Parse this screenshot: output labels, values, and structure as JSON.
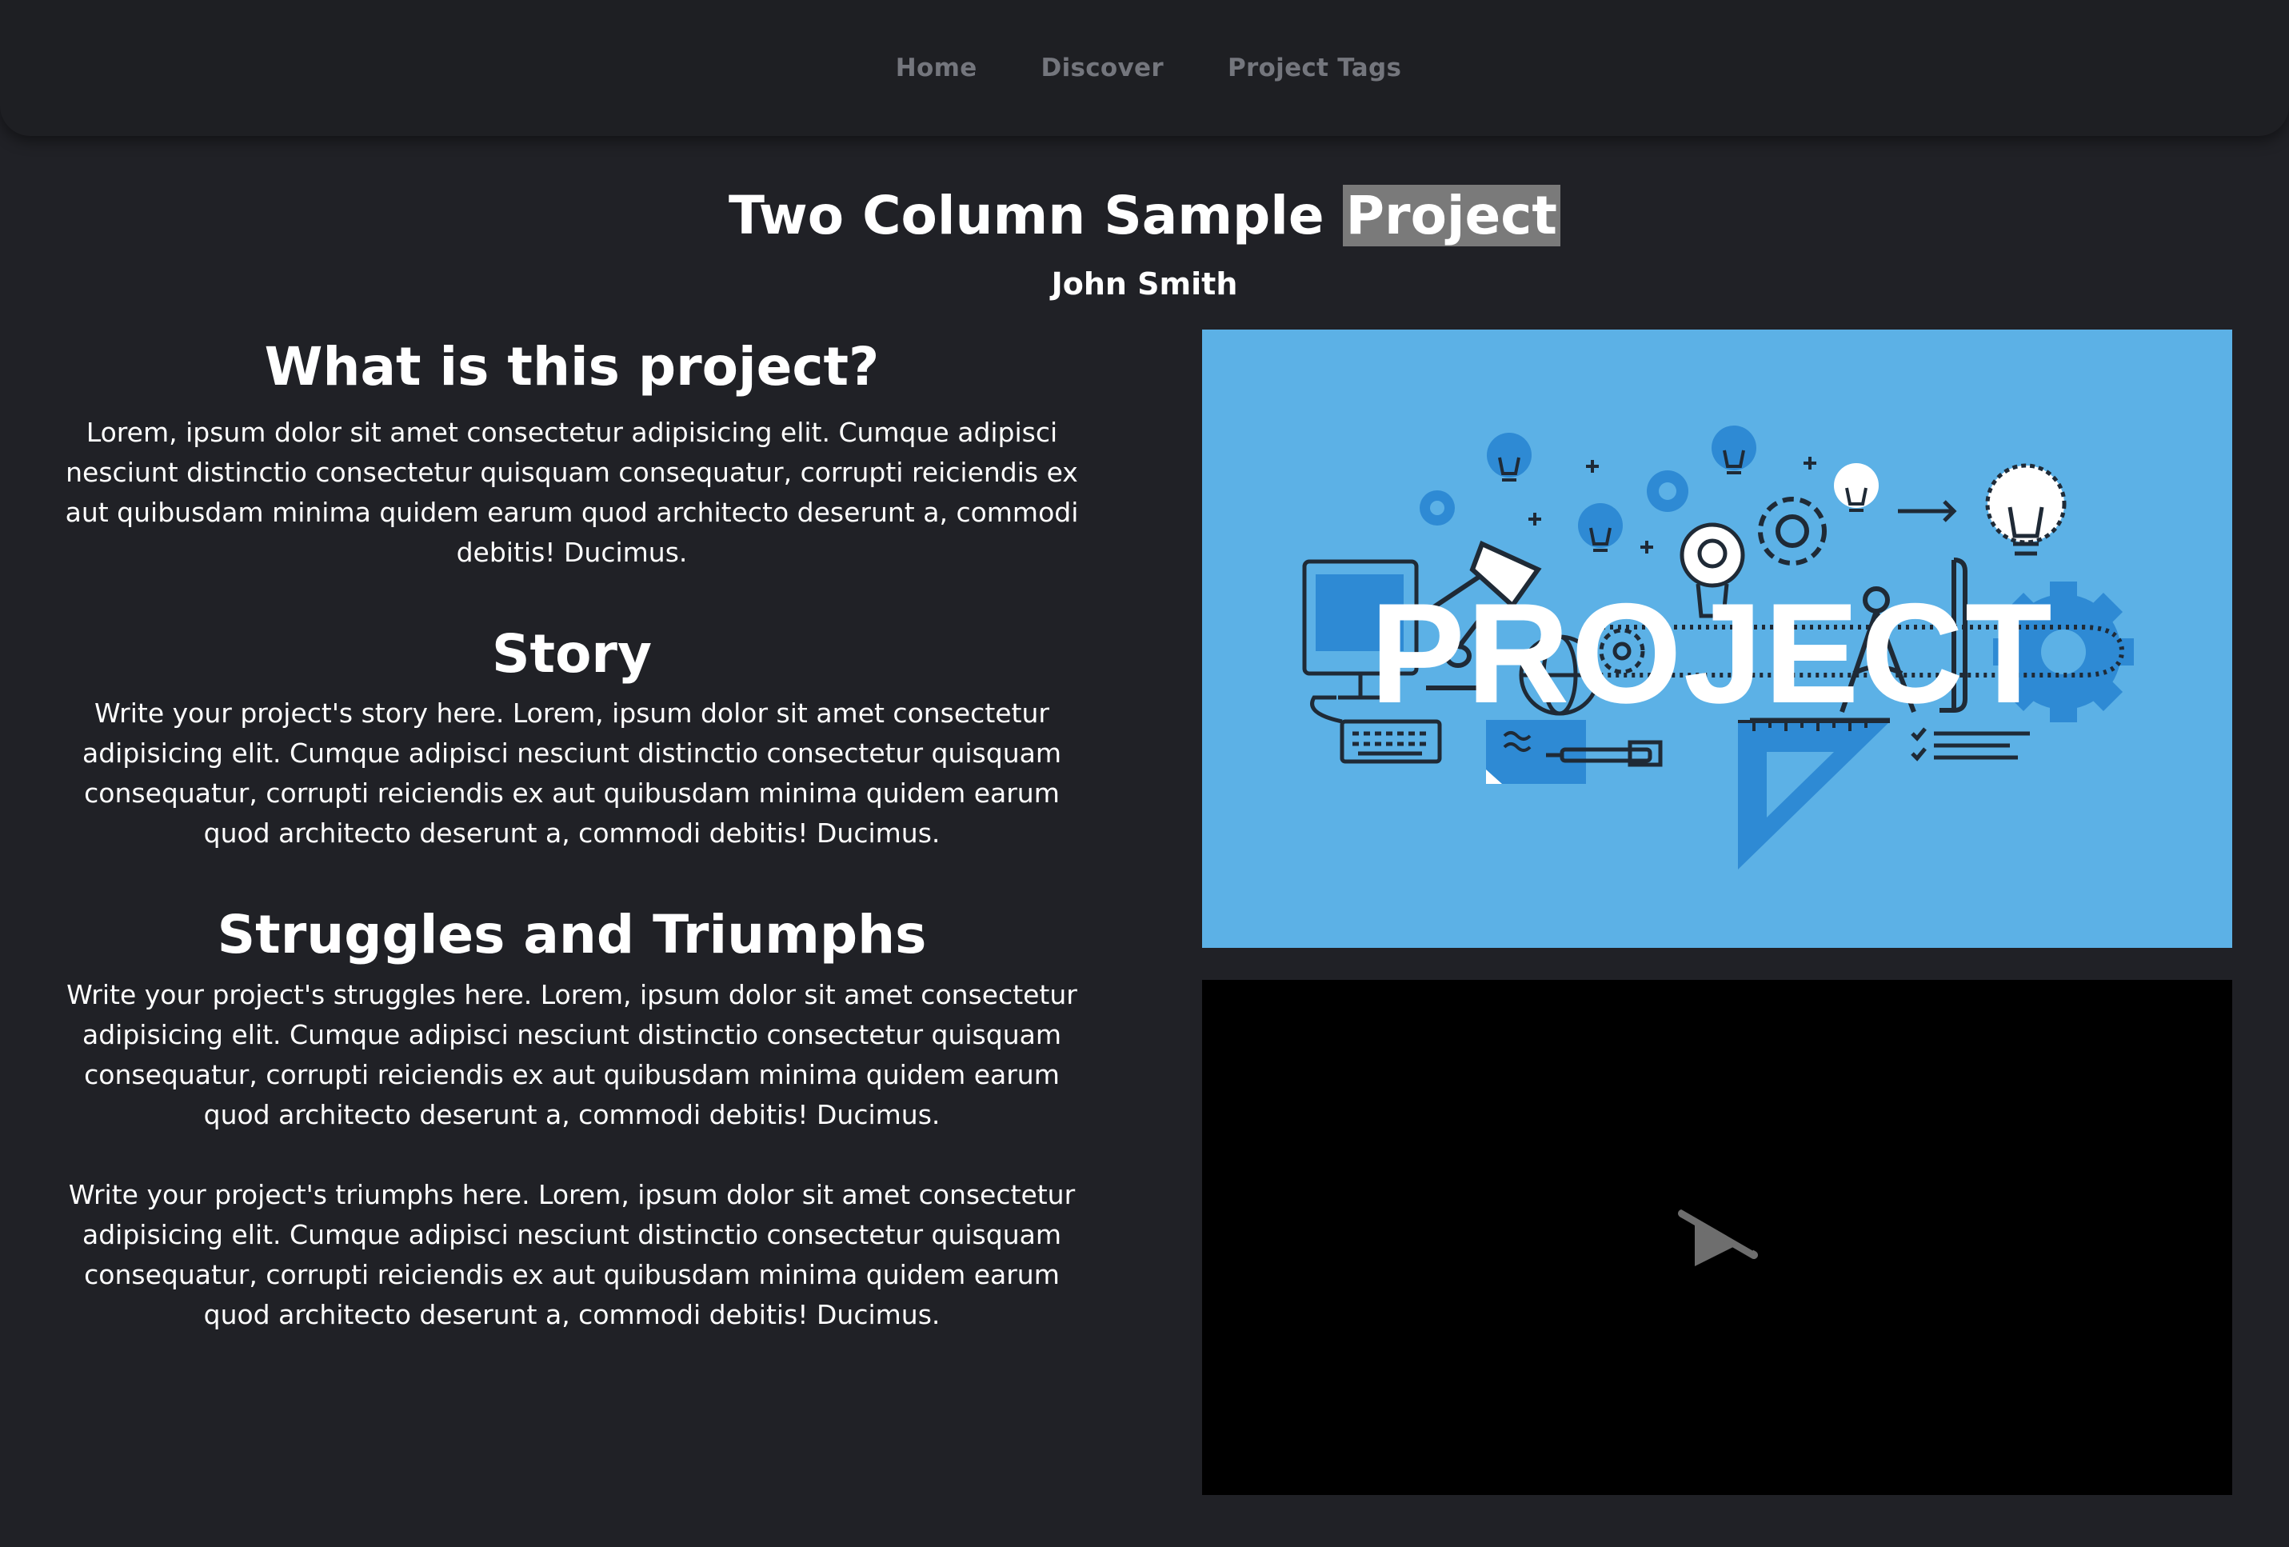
{
  "nav": {
    "items": [
      {
        "label": "Home"
      },
      {
        "label": "Discover"
      },
      {
        "label": "Project Tags"
      }
    ]
  },
  "title": {
    "main": "Two Column Sample ",
    "highlighted": "Project"
  },
  "author": "John Smith",
  "sections": [
    {
      "heading": "What is this project?",
      "paragraphs": [
        "Lorem, ipsum dolor sit amet consectetur adipisicing elit. Cumque adipisci nesciunt distinctio consectetur quisquam consequatur, corrupti reiciendis ex aut quibusdam minima quidem earum quod architecto deserunt a, commodi debitis! Ducimus."
      ]
    },
    {
      "heading": "Story",
      "paragraphs": [
        "Write your project's story here. Lorem, ipsum dolor sit amet consectetur adipisicing elit. Cumque adipisci nesciunt distinctio consectetur quisquam consequatur, corrupti reiciendis ex aut quibusdam minima quidem earum quod architecto deserunt a, commodi debitis! Ducimus."
      ]
    },
    {
      "heading": "Struggles and Triumphs",
      "paragraphs": [
        "Write your project's struggles here. Lorem, ipsum dolor sit amet consectetur adipisicing elit. Cumque adipisci nesciunt distinctio consectetur quisquam consequatur, corrupti reiciendis ex aut quibusdam minima quidem earum quod architecto deserunt a, commodi debitis! Ducimus.",
        "Write your project's triumphs here. Lorem, ipsum dolor sit amet consectetur adipisicing elit. Cumque adipisci nesciunt distinctio consectetur quisquam consequatur, corrupti reiciendis ex aut quibusdam minima quidem earum quod architecto deserunt a, commodi debitis! Ducimus."
      ]
    }
  ],
  "image": {
    "word": "PROJECT",
    "background": "#5cb1e6"
  },
  "video": {
    "icon": "play-disabled-icon"
  },
  "colors": {
    "page_background": "#202126",
    "navbar_background": "#1e1f23",
    "nav_text": "#74767d",
    "text": "#ffffff",
    "highlight": "#7a7a7a",
    "image_blue": "#5cb1e6",
    "icon_dark_blue": "#2e8ad4",
    "video_background": "#000000"
  }
}
